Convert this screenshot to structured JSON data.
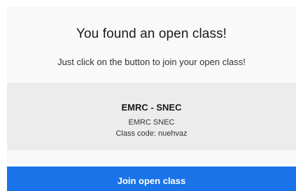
{
  "dialog": {
    "title": "You found an open class!",
    "subtitle": "Just click on the button to join your open class!"
  },
  "class_card": {
    "name": "EMRC - SNEC",
    "description": "EMRC SNEC",
    "code_text": "Class code: nuehvaz"
  },
  "actions": {
    "join_label": "Join open class"
  },
  "colors": {
    "accent": "#1a73e8",
    "panel_background": "#f9f9f9",
    "card_background": "#ececec"
  }
}
